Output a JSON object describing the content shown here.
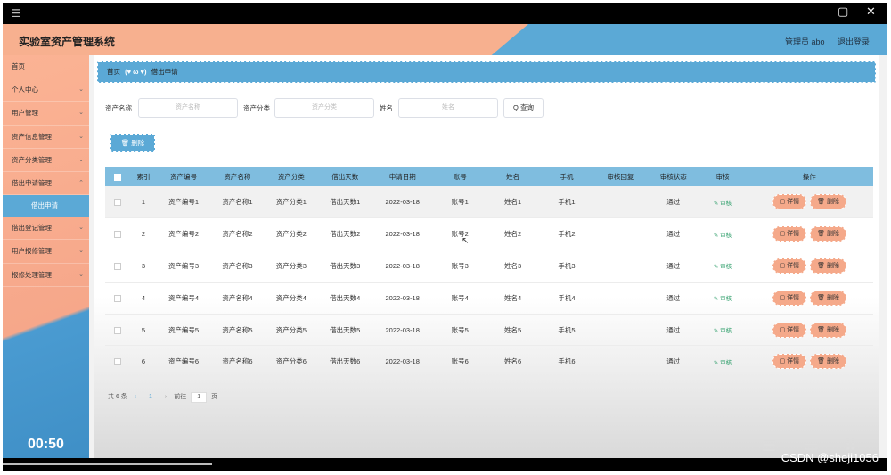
{
  "window": {
    "menu_icon": "☰",
    "minimize": "—",
    "restore": "▢",
    "close": "✕"
  },
  "header": {
    "title": "实验室资产管理系统",
    "user": "管理员 abo",
    "logout": "退出登录"
  },
  "sidebar": {
    "items": [
      {
        "label": "首页"
      },
      {
        "label": "个人中心"
      },
      {
        "label": "用户管理"
      },
      {
        "label": "资产信息管理"
      },
      {
        "label": "资产分类管理"
      },
      {
        "label": "借出申请管理"
      }
    ],
    "active_sub": "借出申请",
    "items_after": [
      {
        "label": "借出登记管理"
      },
      {
        "label": "用户报修管理"
      },
      {
        "label": "报修处理管理"
      }
    ],
    "clock": "00:50"
  },
  "breadcrumb": {
    "home": "首页",
    "separator": "(♥ ω ♥)",
    "current": "借出申请"
  },
  "search": {
    "asset_name_label": "资产名称",
    "asset_name_placeholder": "资产名称",
    "asset_type_label": "资产分类",
    "asset_type_placeholder": "资产分类",
    "name_label": "姓名",
    "name_placeholder": "姓名",
    "query_button": "Q 查询"
  },
  "toolbar": {
    "delete_label": "🗑 删除"
  },
  "table": {
    "headers": [
      "索引",
      "资产编号",
      "资产名称",
      "资产分类",
      "借出天数",
      "申请日期",
      "账号",
      "姓名",
      "手机",
      "审核回复",
      "审核状态",
      "审核",
      "操作"
    ],
    "rows": [
      {
        "idx": "1",
        "code": "资产编号1",
        "name": "资产名称1",
        "type": "资产分类1",
        "days": "借出天数1",
        "date": "2022-03-18",
        "account": "账号1",
        "person": "姓名1",
        "phone": "手机1",
        "reply": "",
        "status": "通过",
        "audit": "✎ 审核"
      },
      {
        "idx": "2",
        "code": "资产编号2",
        "name": "资产名称2",
        "type": "资产分类2",
        "days": "借出天数2",
        "date": "2022-03-18",
        "account": "账号2",
        "person": "姓名2",
        "phone": "手机2",
        "reply": "",
        "status": "通过",
        "audit": "✎ 审核"
      },
      {
        "idx": "3",
        "code": "资产编号3",
        "name": "资产名称3",
        "type": "资产分类3",
        "days": "借出天数3",
        "date": "2022-03-18",
        "account": "账号3",
        "person": "姓名3",
        "phone": "手机3",
        "reply": "",
        "status": "通过",
        "audit": "✎ 审核"
      },
      {
        "idx": "4",
        "code": "资产编号4",
        "name": "资产名称4",
        "type": "资产分类4",
        "days": "借出天数4",
        "date": "2022-03-18",
        "account": "账号4",
        "person": "姓名4",
        "phone": "手机4",
        "reply": "",
        "status": "通过",
        "audit": "✎ 审核"
      },
      {
        "idx": "5",
        "code": "资产编号5",
        "name": "资产名称5",
        "type": "资产分类5",
        "days": "借出天数5",
        "date": "2022-03-18",
        "account": "账号5",
        "person": "姓名5",
        "phone": "手机5",
        "reply": "",
        "status": "通过",
        "audit": "✎ 审核"
      },
      {
        "idx": "6",
        "code": "资产编号6",
        "name": "资产名称6",
        "type": "资产分类6",
        "days": "借出天数6",
        "date": "2022-03-18",
        "account": "账号6",
        "person": "姓名6",
        "phone": "手机6",
        "reply": "",
        "status": "通过",
        "audit": "✎ 审核"
      }
    ],
    "detail_label": "▢ 详情",
    "delete_label": "🗑 删除"
  },
  "pager": {
    "total": "共 6 条",
    "prev": "‹",
    "page": "1",
    "next": "›",
    "goto": "前往",
    "goto_value": "1",
    "unit": "页"
  },
  "overlay": {
    "list_icon": "☰",
    "screen_icon": "▭",
    "grid_icon": "⠿"
  },
  "watermark": "CSDN @sheji1056",
  "colors": {
    "blue": "#5ba9d6",
    "salmon": "#f7b08f",
    "green": "#2e9e6a"
  }
}
